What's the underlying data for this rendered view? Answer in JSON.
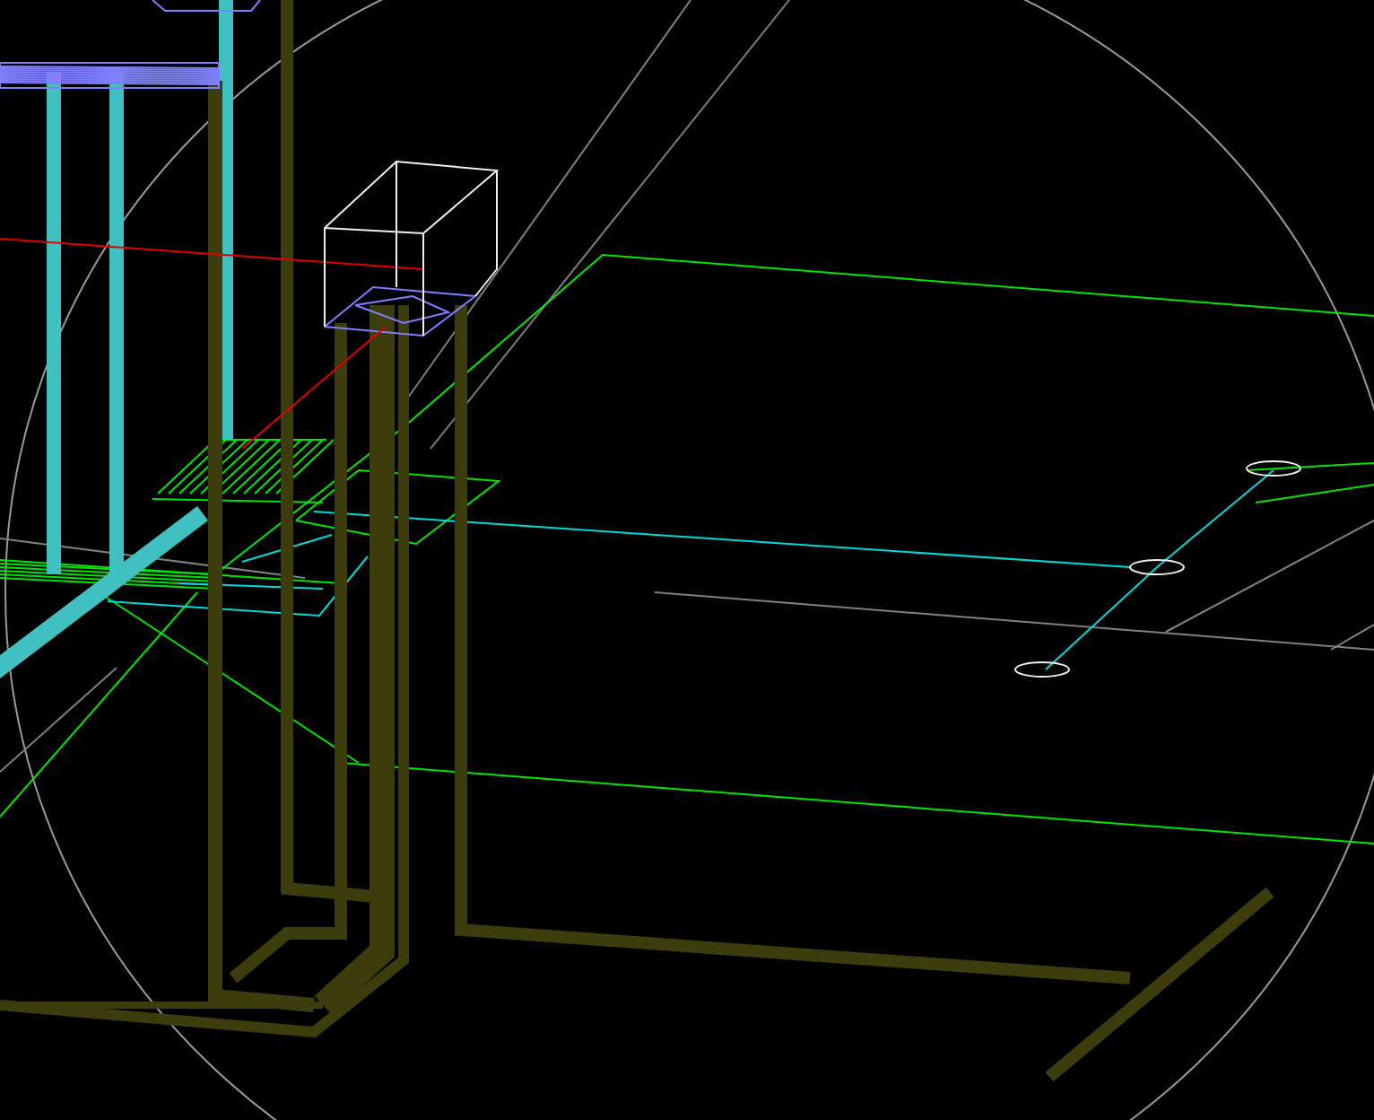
{
  "viewport": {
    "kind": "cad-3d-view",
    "layers": [
      {
        "kind": "view-boundary"
      },
      {
        "kind": "guide"
      },
      {
        "kind": "outline"
      },
      {
        "kind": "route"
      },
      {
        "kind": "column"
      },
      {
        "kind": "pipe"
      },
      {
        "kind": "box"
      },
      {
        "kind": "axis"
      },
      {
        "kind": "marker"
      }
    ]
  }
}
